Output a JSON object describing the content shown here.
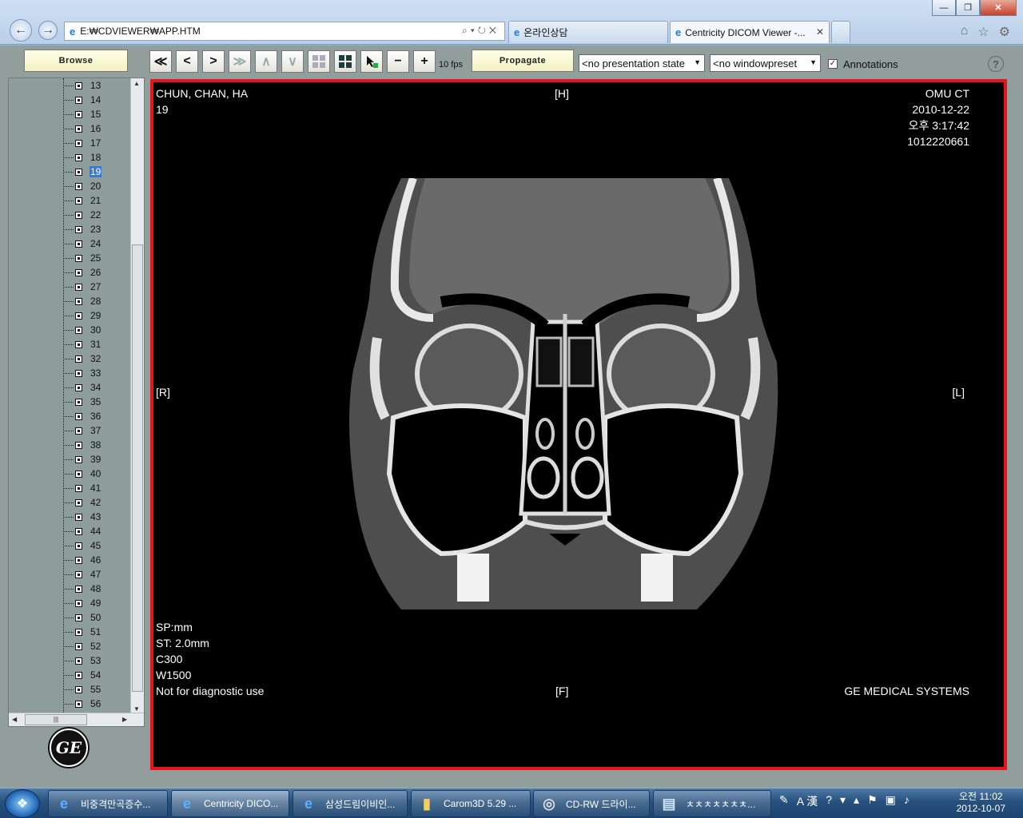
{
  "browser": {
    "address": "E:₩CDVIEWER₩APP.HTM",
    "tabs": [
      {
        "label": "온라인상담"
      },
      {
        "label": "Centricity DICOM Viewer -..."
      }
    ]
  },
  "toolbar": {
    "browse_label": "Browse",
    "fps": "10 fps",
    "propagate_label": "Propagate",
    "presentation_state": "<no presentation state",
    "window_preset": "<no windowpreset",
    "annotations_label": "Annotations",
    "annotations_checked": "✓"
  },
  "tree": {
    "selected": "19",
    "items": [
      "13",
      "14",
      "15",
      "16",
      "17",
      "18",
      "19",
      "20",
      "21",
      "22",
      "23",
      "24",
      "25",
      "26",
      "27",
      "28",
      "29",
      "30",
      "31",
      "32",
      "33",
      "34",
      "35",
      "36",
      "37",
      "38",
      "39",
      "40",
      "41",
      "42",
      "43",
      "44",
      "45",
      "46",
      "47",
      "48",
      "49",
      "50",
      "51",
      "52",
      "53",
      "54",
      "55",
      "56"
    ]
  },
  "viewer": {
    "top_left": {
      "patient_name": "CHUN, CHAN, HA",
      "image_number": "19"
    },
    "top_center": "[H]",
    "top_right": {
      "institution": "OMU CT",
      "date": "2010-12-22",
      "time": "오후 3:17:42",
      "id": "1012220661"
    },
    "mid_left": "[R]",
    "mid_right": "[L]",
    "bottom_left": {
      "sp": "SP:mm",
      "st": "ST:  2.0mm",
      "center": "C300",
      "width": "W1500",
      "disclaimer": "Not for diagnostic use"
    },
    "bottom_center": "[F]",
    "bottom_right": "GE MEDICAL SYSTEMS"
  },
  "taskbar": {
    "items": [
      "비중격만곡증수...",
      "Centricity DICO...",
      "삼성드림이비인...",
      "Carom3D 5.29 ...",
      "CD-RW 드라이...",
      "ㅊㅊㅊㅊㅊㅊㅊ..."
    ],
    "ime": "A 漢",
    "clock_time": "오전 11:02",
    "clock_date": "2012-10-07"
  }
}
